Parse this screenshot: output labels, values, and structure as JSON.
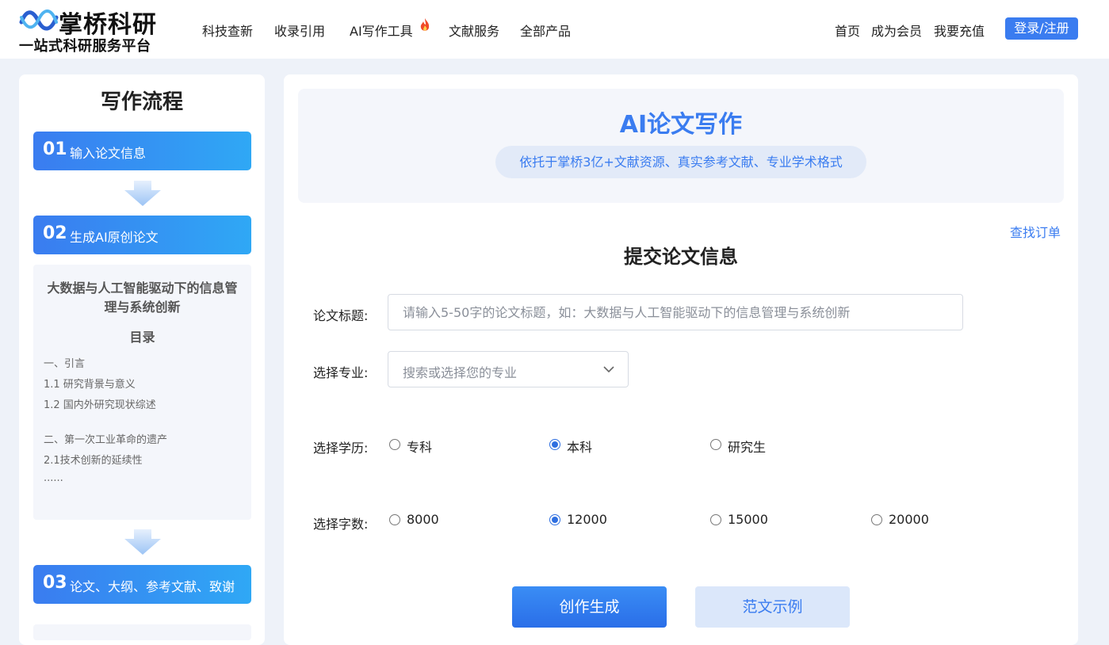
{
  "brand": {
    "name": "掌桥科研",
    "slogan": "一站式科研服务平台"
  },
  "nav": {
    "items": [
      "科技查新",
      "收录引用",
      "AI写作工具",
      "文献服务",
      "全部产品"
    ],
    "right": [
      "首页",
      "成为会员",
      "我要充值"
    ],
    "login": "登录/注册"
  },
  "flow": {
    "title": "写作流程",
    "steps": [
      {
        "num": "01",
        "label": "输入论文信息"
      },
      {
        "num": "02",
        "label": "生成AI原创论文"
      },
      {
        "num": "03",
        "label": "论文、大纲、参考文献、致谢"
      }
    ],
    "outline": {
      "title": "大数据与人工智能驱动下的信息管理与系统创新",
      "toc_heading": "目录",
      "lines": [
        "一、引言",
        "1.1 研究背景与意义",
        "1.2 国内外研究现状综述",
        "二、第一次工业革命的遗产",
        "2.1技术创新的延续性",
        "......"
      ]
    }
  },
  "hero": {
    "title": "AI论文写作",
    "subtitle": "依托于掌桥3亿+文献资源、真实参考文献、专业学术格式"
  },
  "form": {
    "find_order": "查找订单",
    "title": "提交论文信息",
    "title_label": "论文标题:",
    "title_placeholder": "请输入5-50字的论文标题，如：大数据与人工智能驱动下的信息管理与系统创新",
    "major_label": "选择专业:",
    "major_placeholder": "搜索或选择您的专业",
    "degree_label": "选择学历:",
    "degree_options": [
      {
        "label": "专科",
        "checked": false
      },
      {
        "label": "本科",
        "checked": true
      },
      {
        "label": "研究生",
        "checked": false
      }
    ],
    "words_label": "选择字数:",
    "word_options": [
      {
        "label": "8000",
        "checked": false
      },
      {
        "label": "12000",
        "checked": true
      },
      {
        "label": "15000",
        "checked": false
      },
      {
        "label": "20000",
        "checked": false
      }
    ],
    "create_button": "创作生成",
    "sample_button": "范文示例"
  },
  "colors": {
    "accent": "#3a7cf0",
    "page_bg": "#eef2f9",
    "panel_bg": "#f4f6fb"
  }
}
